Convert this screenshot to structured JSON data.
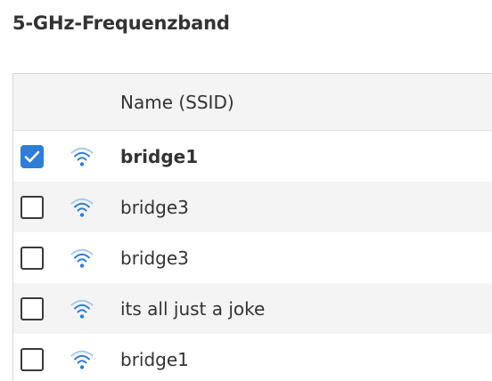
{
  "section": {
    "title": "5-GHz-Frequenzband"
  },
  "table": {
    "header": {
      "name_column": "Name (SSID)"
    },
    "rows": [
      {
        "ssid": "bridge1",
        "checked": true,
        "icon": "wifi-icon"
      },
      {
        "ssid": "bridge3",
        "checked": false,
        "icon": "wifi-icon"
      },
      {
        "ssid": "bridge3",
        "checked": false,
        "icon": "wifi-icon"
      },
      {
        "ssid": "its all just a joke",
        "checked": false,
        "icon": "wifi-icon"
      },
      {
        "ssid": "bridge1",
        "checked": false,
        "icon": "wifi-icon"
      }
    ]
  },
  "colors": {
    "accent": "#2f7dd6",
    "wifi": "#2f7dd6",
    "wifi_faded": "#a9c8ea",
    "row_stripe": "#f4f4f4"
  }
}
